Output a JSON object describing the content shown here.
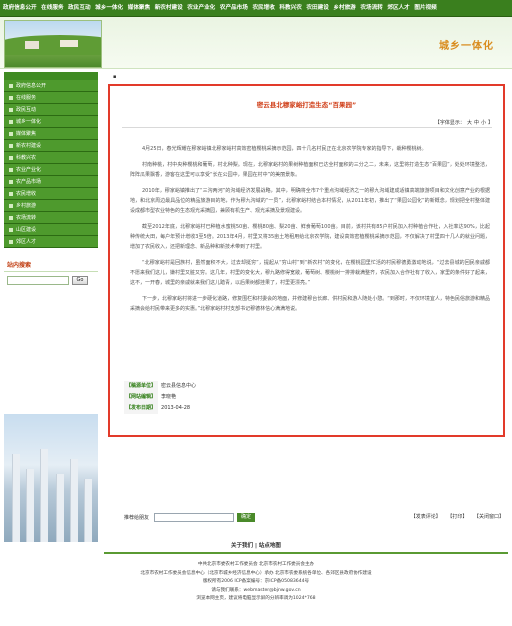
{
  "topnav": {
    "items": [
      "政府信息公开",
      "在线服务",
      "政民互动",
      "城乡一体化",
      "媒体聚焦",
      "新农村建设",
      "农业产业化",
      "农产品市场",
      "农民增收",
      "科教兴农",
      "农田建设",
      "乡村旅游",
      "农场流转",
      "郊区人才",
      "图片视频"
    ]
  },
  "banner": {
    "title": "城乡一体化"
  },
  "sidebar": {
    "items": [
      "政府信息公开",
      "在线服务",
      "政民互动",
      "城乡一体化",
      "媒体聚焦",
      "新农村建设",
      "科教兴农",
      "农业产业化",
      "农产品市场",
      "农民增收",
      "乡村旅游",
      "农场流转",
      "山区建设",
      "郊区人才"
    ],
    "search_title": "站内搜索",
    "go_label": "Go"
  },
  "article": {
    "title": "密云县北穆家峪打造生态“百果园”",
    "fontsize": {
      "label": "【字体显示：",
      "large": "大",
      "medium": "中",
      "small": "小",
      "close": "】"
    },
    "paragraphs": [
      "4月25日，春光辉耀在穆家峪镇北穆家峪村高效密植樱桃采摘示范园，四十几名村民正在北京农学院专家的指导下，栽种樱桃树。",
      "村南种桃，村中央种樱桃和葡萄，村北种梨。现在，北穆家峪村的果树种植面积已达全村面积的三分之二，未来，这里将打造生态“百果园”，处处环境整洁，阵阵瓜果飘香，游客在这里可以享受“长在公园中，果园在村中”的美丽景象。",
      "2010年，穆家峪镇推出了“三沟两河”的沟域经济发展战略，其中，明确将全市7个重点沟域经济之一的穆九沟域建成适镇高端旅游项目和文化创意产业的根据地，和北京周边最具品位的精品旅游目的地，作为穆九沟域的“一员”，北穆家峪村结合本村情况，从2011年初，推出了“果园公园化”的新概念，规划把全村整体建设成都市型农业特色的生态观光采摘园，兼顾有机生产、观光采摘及景观建设。",
      "截至2012年底，北穆家峪村已种植水蜜桃50亩、樱桃80亩、梨20亩、鲜食葡萄100亩。目前，该村共有85户村民加入村种植合作社，入社率达90%，比起种传统大田，每户年预计增收3至5倍。2013年4月，村里又将35亩土地租用给北京农学院，建设高效密植樱桃采摘示范园，不仅解决了村里四十几人的就业问题，增加了农民收入，还把新理念、新品种和新技术带到了村里。",
      "“北穆家峪村是回族村，虽然面积不大，过去却挺穷”，提起从“穷山村”到“新农村”的变化，在樱桃园里忙活的村民穆德勇激动地说，“过去县城的回民亲戚都不愿来我们这儿，嫌村里又脏又穷。这几年，村里的变化大，穆九路修得宽敞，葡萄树、樱桃树一排排栽满整齐，农民加入合作社有了收入，家里的条件好了起来，这不，一开春，城里的亲戚就来我们这儿踏青，以后果树都挂果了，村里更漂亮。”",
      "下一步，北穆家峪村将进一步硬化道路，修复围栏和村委会的地面，并修建穆台长廊、供村民和游人随处小憩。“到那时，不仅环境宜人，特色民俗旅游和精品采摘会给村民带来更多的实惠。”北穆家峪村村支部书记穆德林信心满满地说。"
    ]
  },
  "meta": {
    "source_label": "【稿源单位】",
    "source_value": "密云县信息中心",
    "editor_label": "【网站编辑】",
    "editor_value": "李晓艳",
    "date_label": "【发布日期】",
    "date_value": "2013-04-28"
  },
  "recommend": {
    "label": "推荐给朋友",
    "button": "确定"
  },
  "actions": {
    "comment": "【发表评论】",
    "print": "【打印】",
    "close": "【关闭窗口】"
  },
  "footer": {
    "links": [
      "关于我们",
      "站点地图"
    ],
    "separator": "|",
    "lines": [
      "中共北京市委农村工作委员会  北京市农村工作委员会主办",
      "北京市农村工作委员会信息中心（北京市城乡经济信息中心）承办 北京市农委系统各单位、各郊区县政府协作建设",
      "版权所有2006 ICP备案编号：京ICP备05083644号",
      "请与我们联系：webmaster@bjnw.gov.cn",
      "浏览本网主页，建议将电脑显示屏的分辨率调为1024*768"
    ]
  },
  "colors": {
    "nav_green": "#3a7f1e",
    "title_red": "#d0401a",
    "box_red": "#e23a2a",
    "banner_orange": "#d98b1c"
  }
}
